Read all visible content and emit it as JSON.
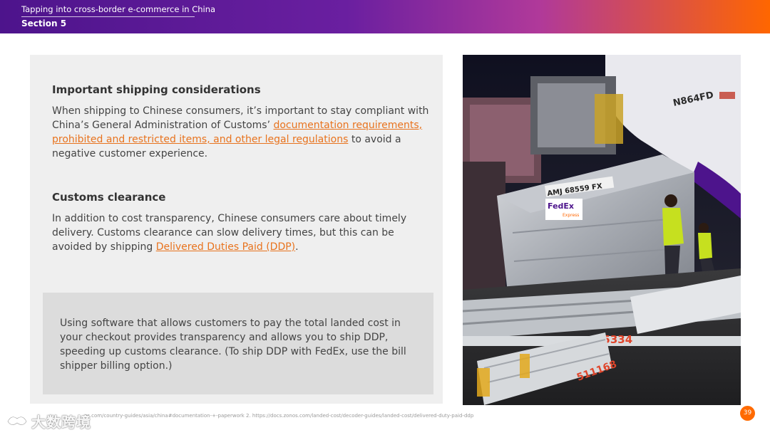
{
  "header": {
    "title": "Tapping into cross-border e-commerce in China",
    "section": "Section 5"
  },
  "shipping": {
    "heading": "Important shipping considerations",
    "text_before": "When shipping to Chinese consumers, it’s important to stay compliant with China’s General Administration of Customs’ ",
    "link": "documentation requirements, prohibited and restricted items, and other legal regulations",
    "text_after": " to avoid a negative customer experience."
  },
  "customs": {
    "heading": "Customs clearance",
    "text_before": "In addition to cost transparency, Chinese consumers care about timely delivery. Customs clearance can slow delivery times, but this can be avoided by shipping ",
    "link": "Delivered Duties Paid (DDP)",
    "text_after": "."
  },
  "callout": {
    "text": "Using software that allows customers to pay the total landed cost in your checkout provides transparency and allows you to ship DDP, speeding up customs clearance. (To ship DDP with FedEx, use the bill shipper billing option.)"
  },
  "photo": {
    "aircraft_reg": "N864FD",
    "container_id": "AMJ 68559 FX",
    "fedex_brand": "FedEx",
    "fedex_sub": "Express",
    "loader_number_1": "35334",
    "loader_number_2": "511168"
  },
  "footer": {
    "footnote": "os.com/country-guides/asia/china#documentation-+-paperwork  2. https://docs.zonos.com/landed-cost/decoder-guides/landed-cost/delivered-duty-paid-ddp",
    "page_number": "39",
    "watermark": "大数跨境"
  },
  "colors": {
    "fedex_purple": "#4d148c",
    "fedex_orange": "#ff6600",
    "link": "#e8731e"
  }
}
